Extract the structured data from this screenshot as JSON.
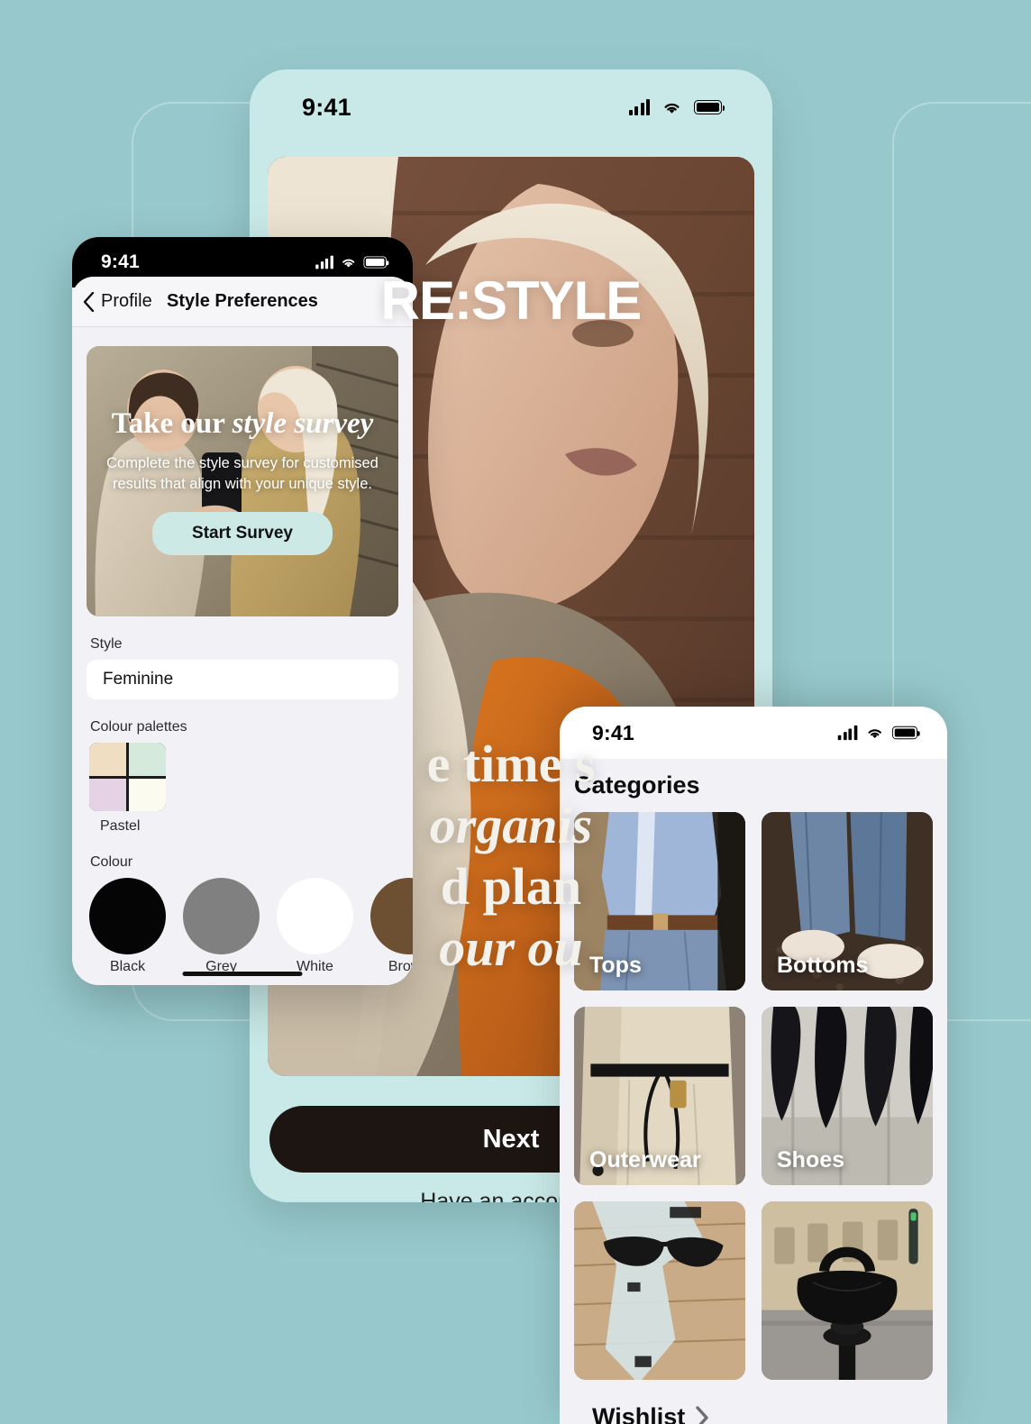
{
  "background_color": "#97c9cc",
  "main_phone": {
    "status_bar": {
      "time": "9:41",
      "signal": "signal-bars-icon",
      "wifi": "wifi-icon",
      "battery": "battery-icon"
    },
    "brand": "RE:STYLE",
    "tagline": {
      "line1": "e time s",
      "line2": "organis",
      "line3": "d plan",
      "line4": "our ou"
    },
    "next_button": "Next",
    "account_prompt": "Have an account?",
    "next_button_color": "#1c1512",
    "screen_color": "#c8e9e8"
  },
  "prefs_phone": {
    "status_bar": {
      "time": "9:41"
    },
    "nav": {
      "back_label": "Profile",
      "title": "Style Preferences"
    },
    "survey_card": {
      "title_plain": "Take our ",
      "title_italic": "style survey",
      "subtitle": "Complete the style survey for customised results that align with your unique style.",
      "button": "Start Survey",
      "button_color": "#cce9e6"
    },
    "style_field": {
      "label": "Style",
      "value": "Feminine"
    },
    "palettes": {
      "label": "Colour palettes",
      "items": [
        {
          "name": "Pastel",
          "colors": [
            "#efdec2",
            "#d5e9dd",
            "#e5d3e5",
            "#fbfbf0"
          ]
        }
      ]
    },
    "colours": {
      "label": "Colour",
      "items": [
        {
          "name": "Black",
          "hex": "#050505"
        },
        {
          "name": "Grey",
          "hex": "#808080"
        },
        {
          "name": "White",
          "hex": "#ffffff"
        },
        {
          "name": "Brown",
          "hex": "#6d4f32"
        }
      ]
    }
  },
  "categories_phone": {
    "status_bar": {
      "time": "9:41"
    },
    "title": "Categories",
    "tiles": [
      {
        "label": "Tops"
      },
      {
        "label": "Bottoms"
      },
      {
        "label": "Outerwear"
      },
      {
        "label": "Shoes"
      },
      {
        "label": ""
      },
      {
        "label": ""
      }
    ],
    "wishlist": {
      "label": "Wishlist",
      "icon": "chevron-right-icon"
    }
  }
}
